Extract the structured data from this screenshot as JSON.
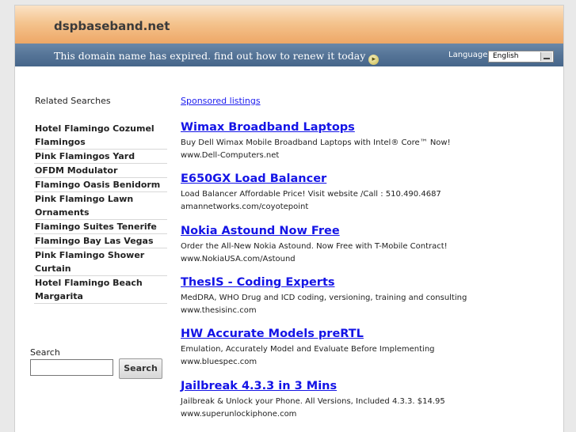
{
  "header": {
    "domain": "dspbaseband.net",
    "expired_message": "This domain name has expired. find out how to renew it today",
    "language_label": "Language:",
    "language_selected": "English"
  },
  "related": {
    "title": "Related Searches",
    "items": [
      {
        "label": "Hotel Flamingo Cozumel Flamingos"
      },
      {
        "label": "Pink Flamingos Yard"
      },
      {
        "label": "OFDM Modulator"
      },
      {
        "label": "Flamingo Oasis Benidorm"
      },
      {
        "label": "Pink Flamingo Lawn Ornaments"
      },
      {
        "label": "Flamingo Suites Tenerife"
      },
      {
        "label": "Flamingo Bay Las Vegas"
      },
      {
        "label": "Pink Flamingo Shower Curtain"
      },
      {
        "label": "Hotel Flamingo Beach Margarita"
      }
    ]
  },
  "search": {
    "label": "Search",
    "button": "Search",
    "value": ""
  },
  "sponsored": {
    "title": "Sponsored listings",
    "listings": [
      {
        "title": "Wimax Broadband Laptops",
        "desc": "Buy Dell Wimax Mobile Broadband Laptops with Intel® Core™ Now!",
        "url": "www.Dell-Computers.net"
      },
      {
        "title": "E650GX Load Balancer",
        "desc": "Load Balancer Affordable Price! Visit website /Call : 510.490.4687",
        "url": "amannetworks.com/coyotepoint"
      },
      {
        "title": "Nokia Astound Now Free",
        "desc": "Order the All-New Nokia Astound. Now Free with T-Mobile Contract!",
        "url": "www.NokiaUSA.com/Astound"
      },
      {
        "title": "ThesIS - Coding Experts",
        "desc": "MedDRA, WHO Drug and ICD coding, versioning, training and consulting",
        "url": "www.thesisinc.com"
      },
      {
        "title": "HW Accurate Models preRTL",
        "desc": "Emulation, Accurately Model and Evaluate Before Implementing",
        "url": "www.bluespec.com"
      },
      {
        "title": "Jailbreak 4.3.3 in 3 Mins",
        "desc": "Jailbreak & Unlock your Phone. All Versions, Included 4.3.3. $14.95",
        "url": "www.superunlockiphone.com"
      }
    ]
  }
}
